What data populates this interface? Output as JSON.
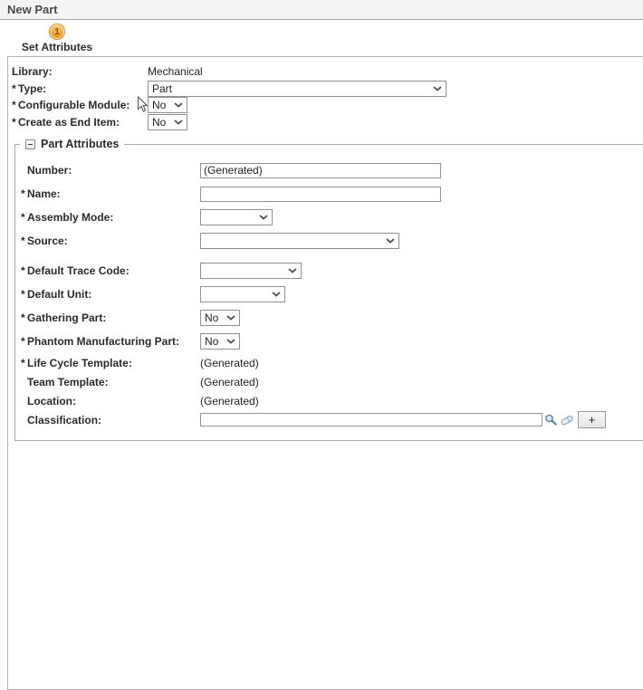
{
  "header": {
    "title": "New Part"
  },
  "wizard": {
    "step_number": "1",
    "step_label": "Set Attributes"
  },
  "required_marker": "*",
  "colors": {
    "accent_orange": "#ee8f12",
    "header_bg": "#f4f4f4",
    "panel_border": "#b3b3b3",
    "control_border": "#919191"
  },
  "general": {
    "library": {
      "label": "Library:",
      "value": "Mechanical"
    },
    "type": {
      "label": "Type:",
      "value": "Part"
    },
    "configurable_module": {
      "label": "Configurable Module:",
      "value": "No"
    },
    "create_as_end_item": {
      "label": "Create as End Item:",
      "value": "No"
    }
  },
  "part_attributes": {
    "legend": "Part Attributes",
    "number": {
      "label": "Number:",
      "value": "(Generated)"
    },
    "name": {
      "label": "Name:",
      "value": ""
    },
    "assembly_mode": {
      "label": "Assembly Mode:",
      "value": ""
    },
    "source": {
      "label": "Source:",
      "value": ""
    },
    "default_trace_code": {
      "label": "Default Trace Code:",
      "value": ""
    },
    "default_unit": {
      "label": "Default Unit:",
      "value": ""
    },
    "gathering_part": {
      "label": "Gathering Part:",
      "value": "No"
    },
    "phantom_manufacturing_part": {
      "label": "Phantom Manufacturing Part:",
      "value": "No"
    },
    "life_cycle_template": {
      "label": "Life Cycle Template:",
      "value": "(Generated)"
    },
    "team_template": {
      "label": "Team Template:",
      "value": "(Generated)"
    },
    "location": {
      "label": "Location:",
      "value": "(Generated)"
    },
    "classification": {
      "label": "Classification:",
      "value": "",
      "add_button_label": "+"
    }
  }
}
